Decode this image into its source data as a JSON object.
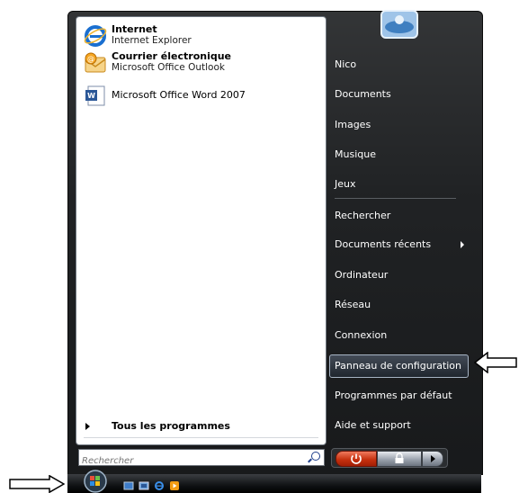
{
  "pinned": [
    {
      "title": "Internet",
      "subtitle": "Internet Explorer",
      "icon": "internet-explorer-icon"
    },
    {
      "title": "Courrier électronique",
      "subtitle": "Microsoft Office Outlook",
      "icon": "outlook-icon"
    }
  ],
  "recent": [
    {
      "label": "Microsoft Office Word 2007",
      "icon": "word-icon"
    }
  ],
  "all_programs_label": "Tous les programmes",
  "search": {
    "placeholder": "Rechercher"
  },
  "right_items": {
    "user": "Nico",
    "documents": "Documents",
    "images": "Images",
    "music": "Musique",
    "games": "Jeux",
    "search": "Rechercher",
    "recent_docs": "Documents récents",
    "computer": "Ordinateur",
    "network": "Réseau",
    "connect": "Connexion",
    "control_panel": "Panneau de configuration",
    "default_programs": "Programmes par défaut",
    "help": "Aide et support"
  },
  "colors": {
    "menu_bg": "#1c1e20",
    "highlight_border": "#a7b4c4",
    "ie_blue": "#1a6fd0",
    "word_blue": "#2b5797"
  }
}
